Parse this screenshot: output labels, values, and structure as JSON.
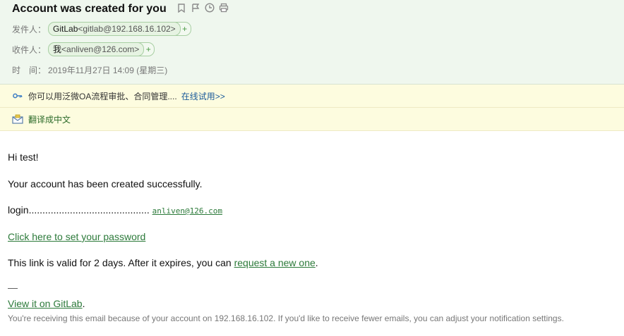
{
  "header": {
    "subject": "Account was created for you",
    "from_label": "发件人：",
    "from_name": "GitLab",
    "from_addr": "<gitlab@192.168.16.102>",
    "to_label": "收件人：",
    "to_name": "我",
    "to_addr": "<anliven@126.com>",
    "time_label": "时　间：",
    "time_value": "2019年11月27日 14:09 (星期三)",
    "plus": "+",
    "tools": [
      "bookmark-icon",
      "flag-icon",
      "clock-icon",
      "print-icon"
    ]
  },
  "banners": {
    "promo_text": "你可以用泛微OA流程审批、合同管理....",
    "promo_link": "在线试用>>",
    "translate": "翻译成中文"
  },
  "body": {
    "greeting": "Hi test!",
    "created": "Your account has been created successfully.",
    "login_label": "login............................................",
    "login_value": "anliven@126.com",
    "set_password": "Click here to set your password",
    "valid_prefix": "This link is valid for 2 days. After it expires, you can ",
    "valid_link": "request a new one",
    "valid_suffix": ".",
    "dash": "—",
    "view_link": "View it on GitLab",
    "view_suffix": ".",
    "footer": "You're receiving this email because of your account on 192.168.16.102. If you'd like to receive fewer emails, you can adjust your notification settings."
  },
  "colors": {
    "header_bg": "#eff7ee",
    "banner_bg": "#fdfcdf",
    "link_green": "#2c7a3a",
    "link_blue": "#1a5a9a"
  }
}
